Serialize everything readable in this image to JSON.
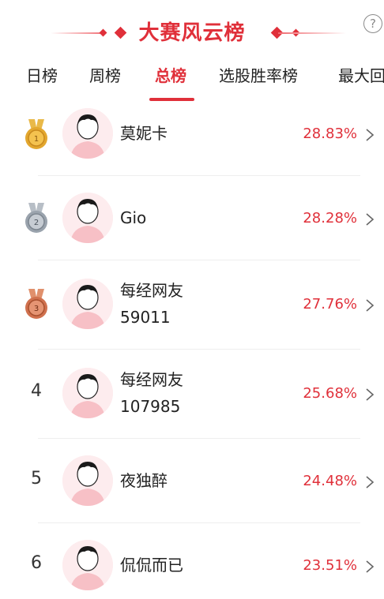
{
  "header": {
    "title": "大赛风云榜",
    "help_icon": "question-circle-icon",
    "help_symbol": "?"
  },
  "tabs": [
    {
      "label": "日榜",
      "active": false
    },
    {
      "label": "周榜",
      "active": false
    },
    {
      "label": "总榜",
      "active": true
    },
    {
      "label": "选股胜率榜",
      "active": false
    },
    {
      "label": "最大回",
      "active": false
    }
  ],
  "rankings": [
    {
      "rank": "1",
      "medal": "gold-medal-icon",
      "name_lines": [
        "莫妮卡"
      ],
      "rate": "28.83%"
    },
    {
      "rank": "2",
      "medal": "silver-medal-icon",
      "name_lines": [
        "Gio"
      ],
      "rate": "28.28%"
    },
    {
      "rank": "3",
      "medal": "bronze-medal-icon",
      "name_lines": [
        "每经网友",
        "59011"
      ],
      "rate": "27.76%"
    },
    {
      "rank": "4",
      "medal": "",
      "name_lines": [
        "每经网友",
        "107985"
      ],
      "rate": "25.68%"
    },
    {
      "rank": "5",
      "medal": "",
      "name_lines": [
        "夜独醉"
      ],
      "rate": "24.48%"
    },
    {
      "rank": "6",
      "medal": "",
      "name_lines": [
        "侃侃而已"
      ],
      "rate": "23.51%"
    }
  ],
  "colors": {
    "accent": "#e0303a",
    "gold": "#e3a72f",
    "silver": "#9aa3ad",
    "bronze": "#d0714e"
  }
}
